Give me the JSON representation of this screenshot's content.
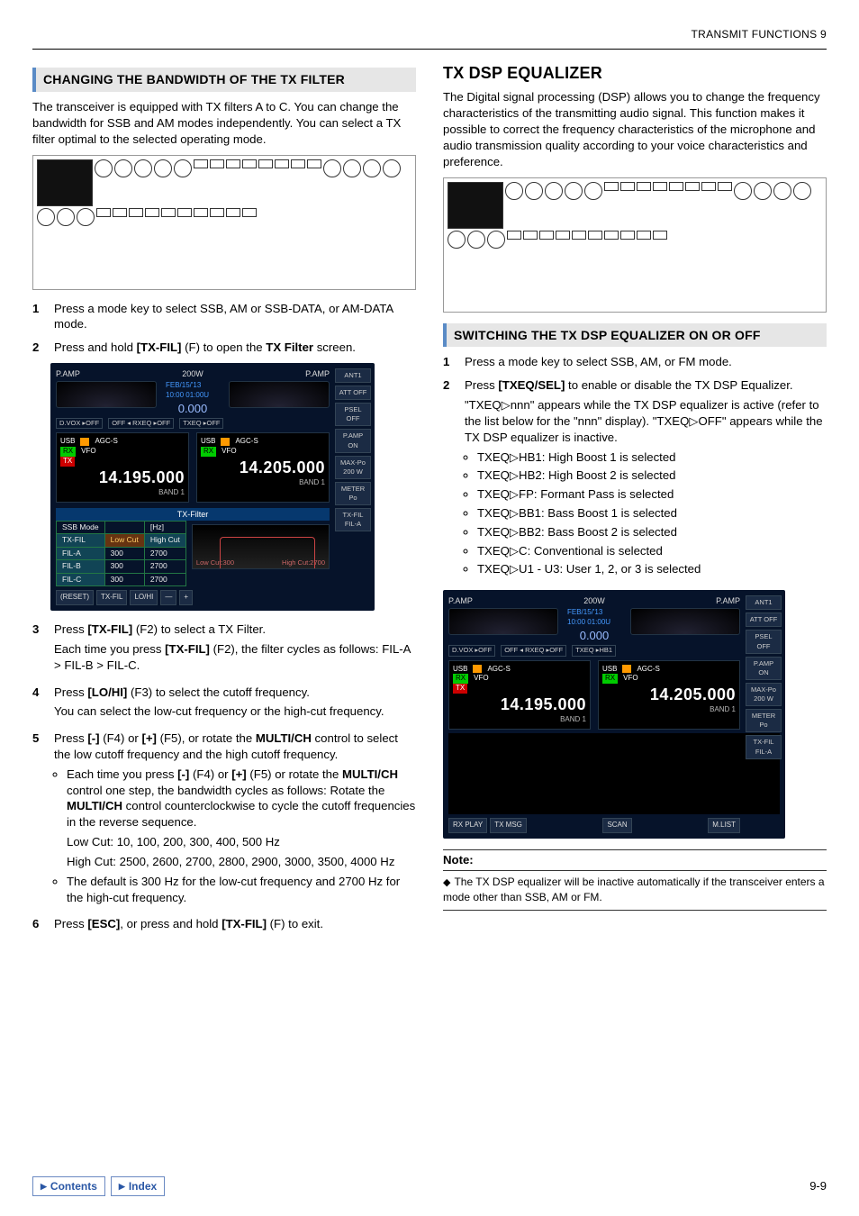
{
  "header": {
    "title": "TRANSMIT FUNCTIONS 9"
  },
  "left": {
    "subsection": "CHANGING THE BANDWIDTH OF THE TX FILTER",
    "intro": "The transceiver is equipped with TX filters A to C. You can change the bandwidth for SSB and AM modes independently. You can select a TX filter optimal to the selected operating mode.",
    "steps": {
      "s1": {
        "num": "1",
        "text": "Press a mode key to select SSB, AM or SSB-DATA, or AM-DATA mode."
      },
      "s2": {
        "num": "2",
        "pre": "Press and hold ",
        "btn": "[TX-FIL]",
        "mid": " (F) to open the ",
        "bold": "TX Filter",
        "post": " screen."
      },
      "s3": {
        "num": "3",
        "l1a": "Press ",
        "l1btn": "[TX-FIL]",
        "l1b": " (F2) to select a TX Filter.",
        "l2a": "Each time you press ",
        "l2btn": "[TX-FIL]",
        "l2b": " (F2), the filter cycles as follows: FIL-A > FIL-B > FIL-C."
      },
      "s4": {
        "num": "4",
        "l1a": "Press ",
        "l1btn": "[LO/HI]",
        "l1b": " (F3) to select the cutoff frequency.",
        "l2": "You can select the low-cut frequency or the high-cut frequency."
      },
      "s5": {
        "num": "5",
        "l1a": "Press ",
        "btn1": "[-]",
        "l1b": " (F4) or ",
        "btn2": "[+]",
        "l1c": " (F5), or rotate the ",
        "bold": "MULTI/CH",
        "l1d": " control to select the low cutoff frequency and the high cutoff frequency.",
        "b1a": "Each time you press ",
        "b1btn1": "[-]",
        "b1b": " (F4) or ",
        "b1btn2": "[+]",
        "b1c": " (F5) or rotate the ",
        "b1bold": "MULTI/CH",
        "b1d": " control one step, the bandwidth cycles as follows: Rotate the ",
        "b1bold2": "MULTI/CH",
        "b1e": " control counterclockwise to cycle the cutoff frequencies in the reverse sequence.",
        "low": "Low Cut: 10, 100, 200, 300, 400, 500 Hz",
        "high": "High Cut: 2500, 2600, 2700, 2800, 2900, 3000, 3500, 4000 Hz",
        "b2": "The default is 300 Hz for the low-cut frequency and 2700 Hz for the high-cut frequency."
      },
      "s6": {
        "num": "6",
        "a": "Press ",
        "btn1": "[ESC]",
        "b": ", or press and hold ",
        "btn2": "[TX-FIL]",
        "c": " (F) to exit."
      }
    },
    "ss": {
      "pamp": "P.AMP",
      "pow": "200W",
      "ant": "ANT1",
      "att": "ATT OFF",
      "date": "FEB/15/'13",
      "time": "10:00 01:00U",
      "sub": "0.000",
      "dvox": "D.VOX ▸OFF",
      "rxeq": "OFF ◂ RXEQ ▸OFF",
      "txeq": "TXEQ ▸OFF",
      "usb": "USB",
      "agcs": "AGC-S",
      "vfo": "VFO",
      "freqA": "14.195.000",
      "freqB": "14.205.000",
      "band": "BAND 1",
      "psel": "PSEL OFF",
      "pampOn": "P.AMP ON",
      "maxpo": "MAX-Po 200 W",
      "meter": "METER Po",
      "txfil": "TX-FIL FIL-A",
      "title2": "TX-Filter",
      "ths": "SSB Mode",
      "thh": "[Hz]",
      "lc": "Low Cut",
      "hc": "High Cut",
      "filA": "FIL-A",
      "filB": "FIL-B",
      "filC": "FIL-C",
      "v300": "300",
      "v2700": "2700",
      "low300": "Low Cut:300",
      "high2700": "High Cut:2700",
      "fk1": "(RESET)",
      "fk2": "TX-FIL",
      "fk3": "LO/HI",
      "fk4": "—",
      "fk5": "+"
    }
  },
  "right": {
    "section": "TX DSP EQUALIZER",
    "intro": "The Digital signal processing (DSP) allows you to change the frequency characteristics of the transmitting audio signal. This function makes it possible to correct the frequency characteristics of the microphone and audio transmission quality according to your voice characteristics and preference.",
    "subsection": "SWITCHING THE TX DSP EQUALIZER ON OR OFF",
    "steps": {
      "s1": {
        "num": "1",
        "text": "Press a mode key to select SSB, AM, or FM mode."
      },
      "s2": {
        "num": "2",
        "a": "Press ",
        "btn": "[TXEQ/SEL]",
        "b": " to enable or disable the TX DSP Equalizer.",
        "note": "\"TXEQ▷nnn\" appears while the TX DSP equalizer is active (refer to the list below for the \"nnn\" display). \"TXEQ▷OFF\" appears while the TX DSP equalizer is inactive."
      }
    },
    "eq": {
      "i1": "TXEQ▷HB1: High Boost 1 is selected",
      "i2": "TXEQ▷HB2: High Boost 2 is selected",
      "i3": "TXEQ▷FP: Formant Pass is selected",
      "i4": "TXEQ▷BB1: Bass Boost 1 is selected",
      "i5": "TXEQ▷BB2: Bass Boost 2 is selected",
      "i6": "TXEQ▷C: Conventional is selected",
      "i7": "TXEQ▷U1 - U3: User 1, 2, or 3 is selected"
    },
    "ss": {
      "pamp": "P.AMP",
      "pow": "200W",
      "ant": "ANT1",
      "att": "ATT OFF",
      "date": "FEB/15/'13",
      "time": "10:00 01:00U",
      "sub": "0.000",
      "dvox": "D.VOX ▸OFF",
      "rxeq": "OFF ◂ RXEQ ▸OFF",
      "txeq": "TXEQ ▸HB1",
      "usb": "USB",
      "agcs": "AGC-S",
      "vfo": "VFO",
      "freqA": "14.195.000",
      "freqB": "14.205.000",
      "band": "BAND 1",
      "psel": "PSEL OFF",
      "pampOn": "P.AMP ON",
      "maxpo": "MAX-Po 200 W",
      "meter": "METER Po",
      "txfil": "TX-FIL FIL-A",
      "fk1": "RX PLAY",
      "fk2": "TX MSG",
      "fk3": "SCAN",
      "fk4": "M.LIST"
    },
    "note": {
      "hdr": "Note:",
      "body": "The TX DSP equalizer will be inactive automatically if the transceiver enters a mode other than SSB, AM or FM."
    }
  },
  "footer": {
    "contents": "Contents",
    "index": "Index",
    "page": "9-9"
  }
}
